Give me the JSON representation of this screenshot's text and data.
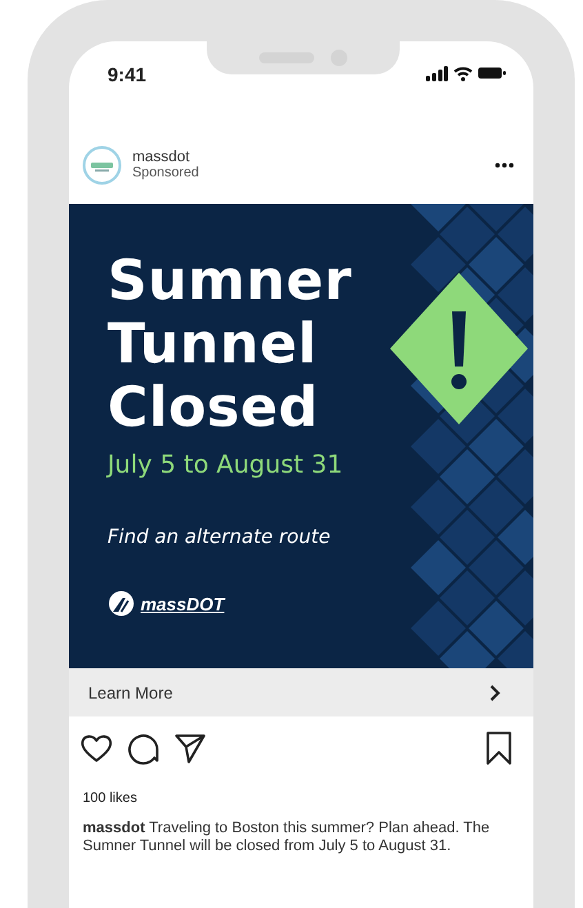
{
  "status_bar": {
    "time": "9:41"
  },
  "post": {
    "account": "massdot",
    "subtitle": "Sponsored",
    "ad": {
      "headline": [
        "Sumner",
        "Tunnel",
        "Closed"
      ],
      "dates": "July 5 to August 31",
      "tagline": "Find an alternate route",
      "logo_text": "massDOT"
    },
    "cta": {
      "label": "Learn More"
    },
    "likes": "100 likes",
    "caption": "**massdot** Traveling to Boston this summer? Plan ahead. The Sumner Tunnel will be closed from July 5 to August 31."
  }
}
